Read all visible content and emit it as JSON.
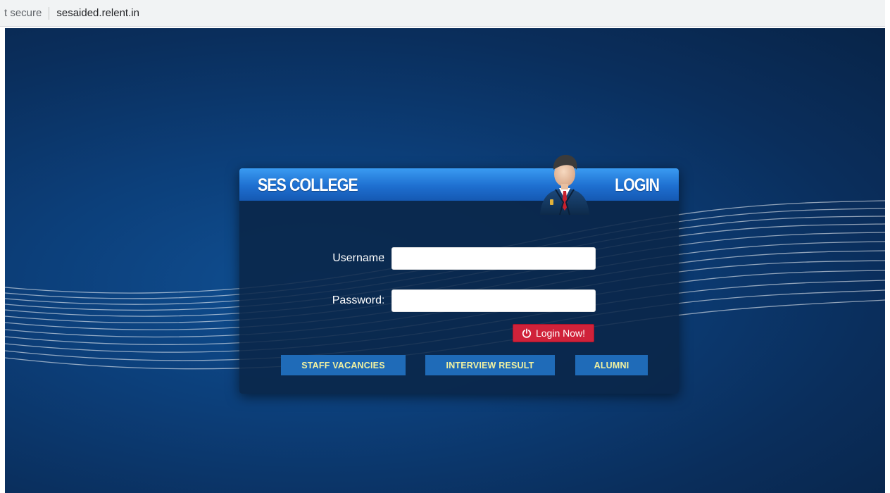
{
  "browser": {
    "security_text": "t secure",
    "url": "sesaided.relent.in"
  },
  "panel": {
    "brand": "SES COLLEGE",
    "title": "LOGIN"
  },
  "form": {
    "username_label": "Username",
    "password_label": "Password",
    "colon": ":",
    "username_value": "",
    "password_value": "",
    "login_button": "Login Now!"
  },
  "nav": {
    "staff_vacancies": "STAFF VACANCIES",
    "interview_result": "INTERVIEW RESULT",
    "alumni": "ALUMNI"
  },
  "icons": {
    "avatar": "businessman-avatar-icon",
    "login": "power-icon"
  },
  "colors": {
    "header_blue": "#1e6fd0",
    "login_red": "#d0223a",
    "nav_blue": "#1f6bb8",
    "nav_text": "#f2f2a0"
  }
}
